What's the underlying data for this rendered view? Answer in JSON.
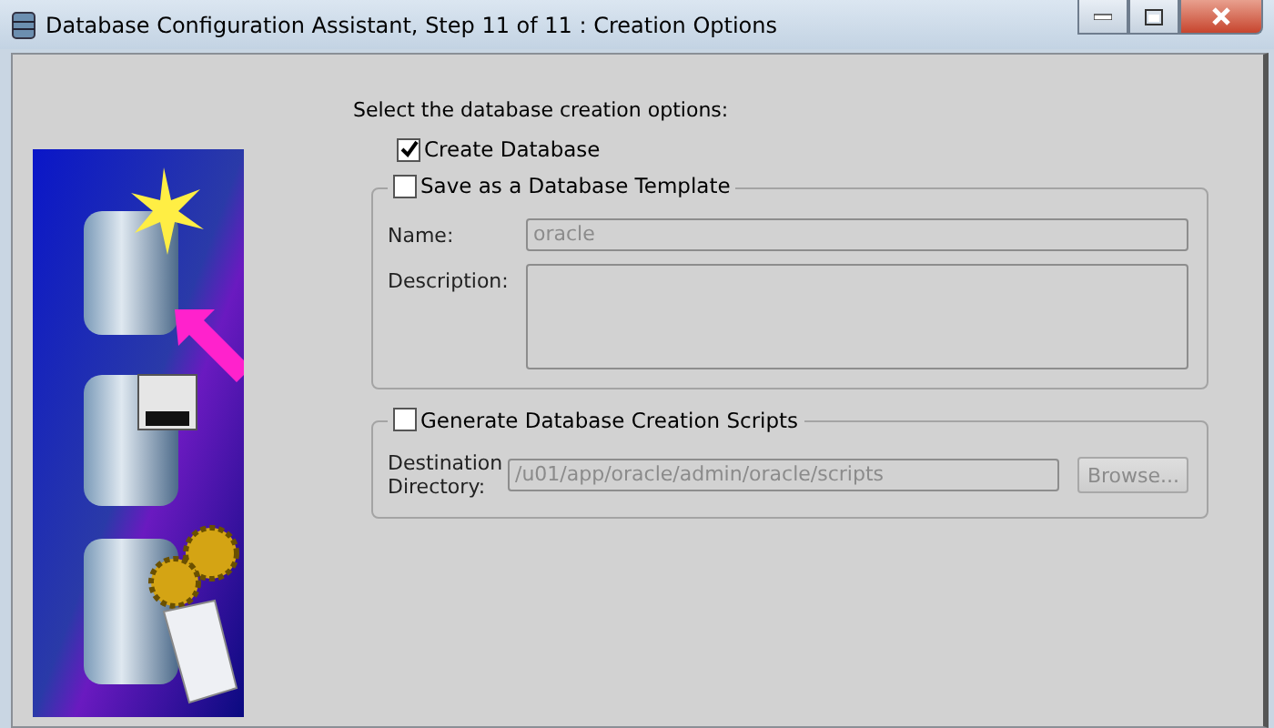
{
  "window": {
    "title": "Database Configuration Assistant, Step 11 of 11 : Creation Options"
  },
  "prompt": "Select the database creation options:",
  "create_database": {
    "label": "Create Database",
    "checked": true
  },
  "template_group": {
    "label": "Save as a Database Template",
    "checked": false,
    "name": {
      "label": "Name:",
      "value": "oracle",
      "disabled": true
    },
    "description": {
      "label": "Description:",
      "disabled": true
    }
  },
  "scripts_group": {
    "label": "Generate Database Creation Scripts",
    "checked": false,
    "destination": {
      "label": "Destination Directory:",
      "value": "/u01/app/oracle/admin/oracle/scripts",
      "disabled": true
    },
    "browse": {
      "label": "Browse...",
      "disabled": true
    }
  }
}
